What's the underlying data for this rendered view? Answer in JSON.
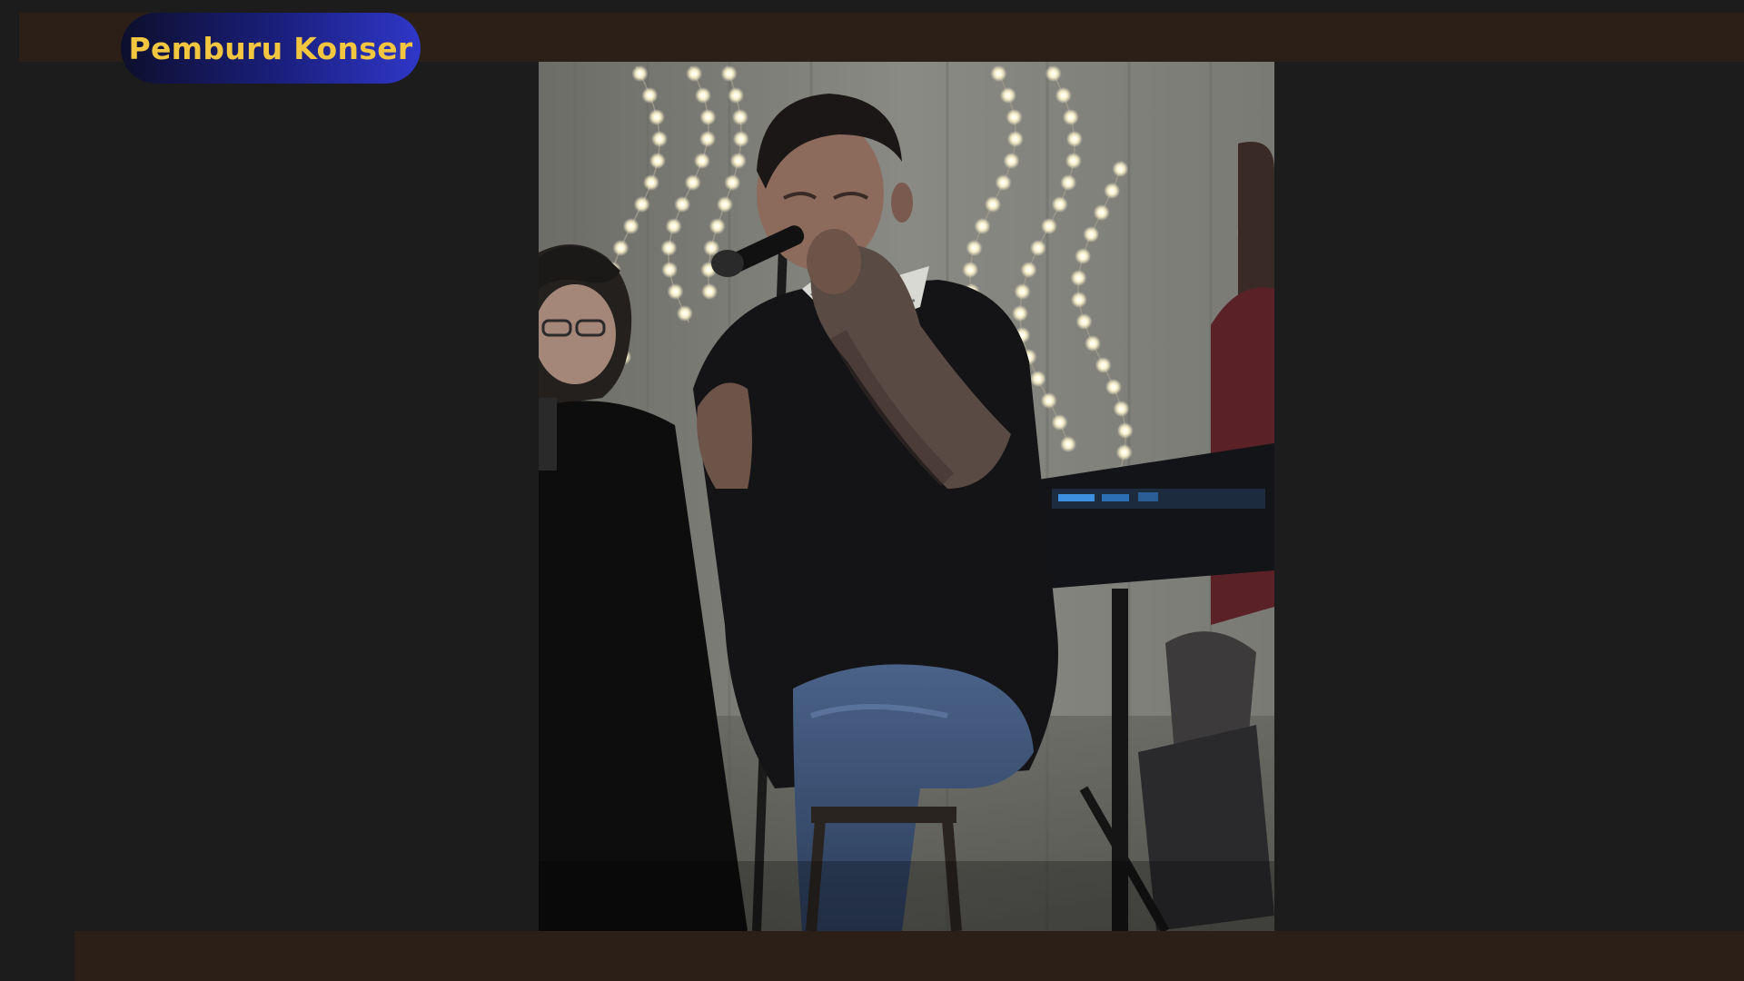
{
  "overlay": {
    "badge_label": "Pemburu Konser",
    "badge_text_color": "#f3c640",
    "badge_gradient": [
      "#0d0f2c",
      "#2f37c8"
    ]
  },
  "colors": {
    "background": "#1c1c1c",
    "bars": "#2b1f17"
  },
  "video": {
    "description_icon": "video-frame"
  }
}
